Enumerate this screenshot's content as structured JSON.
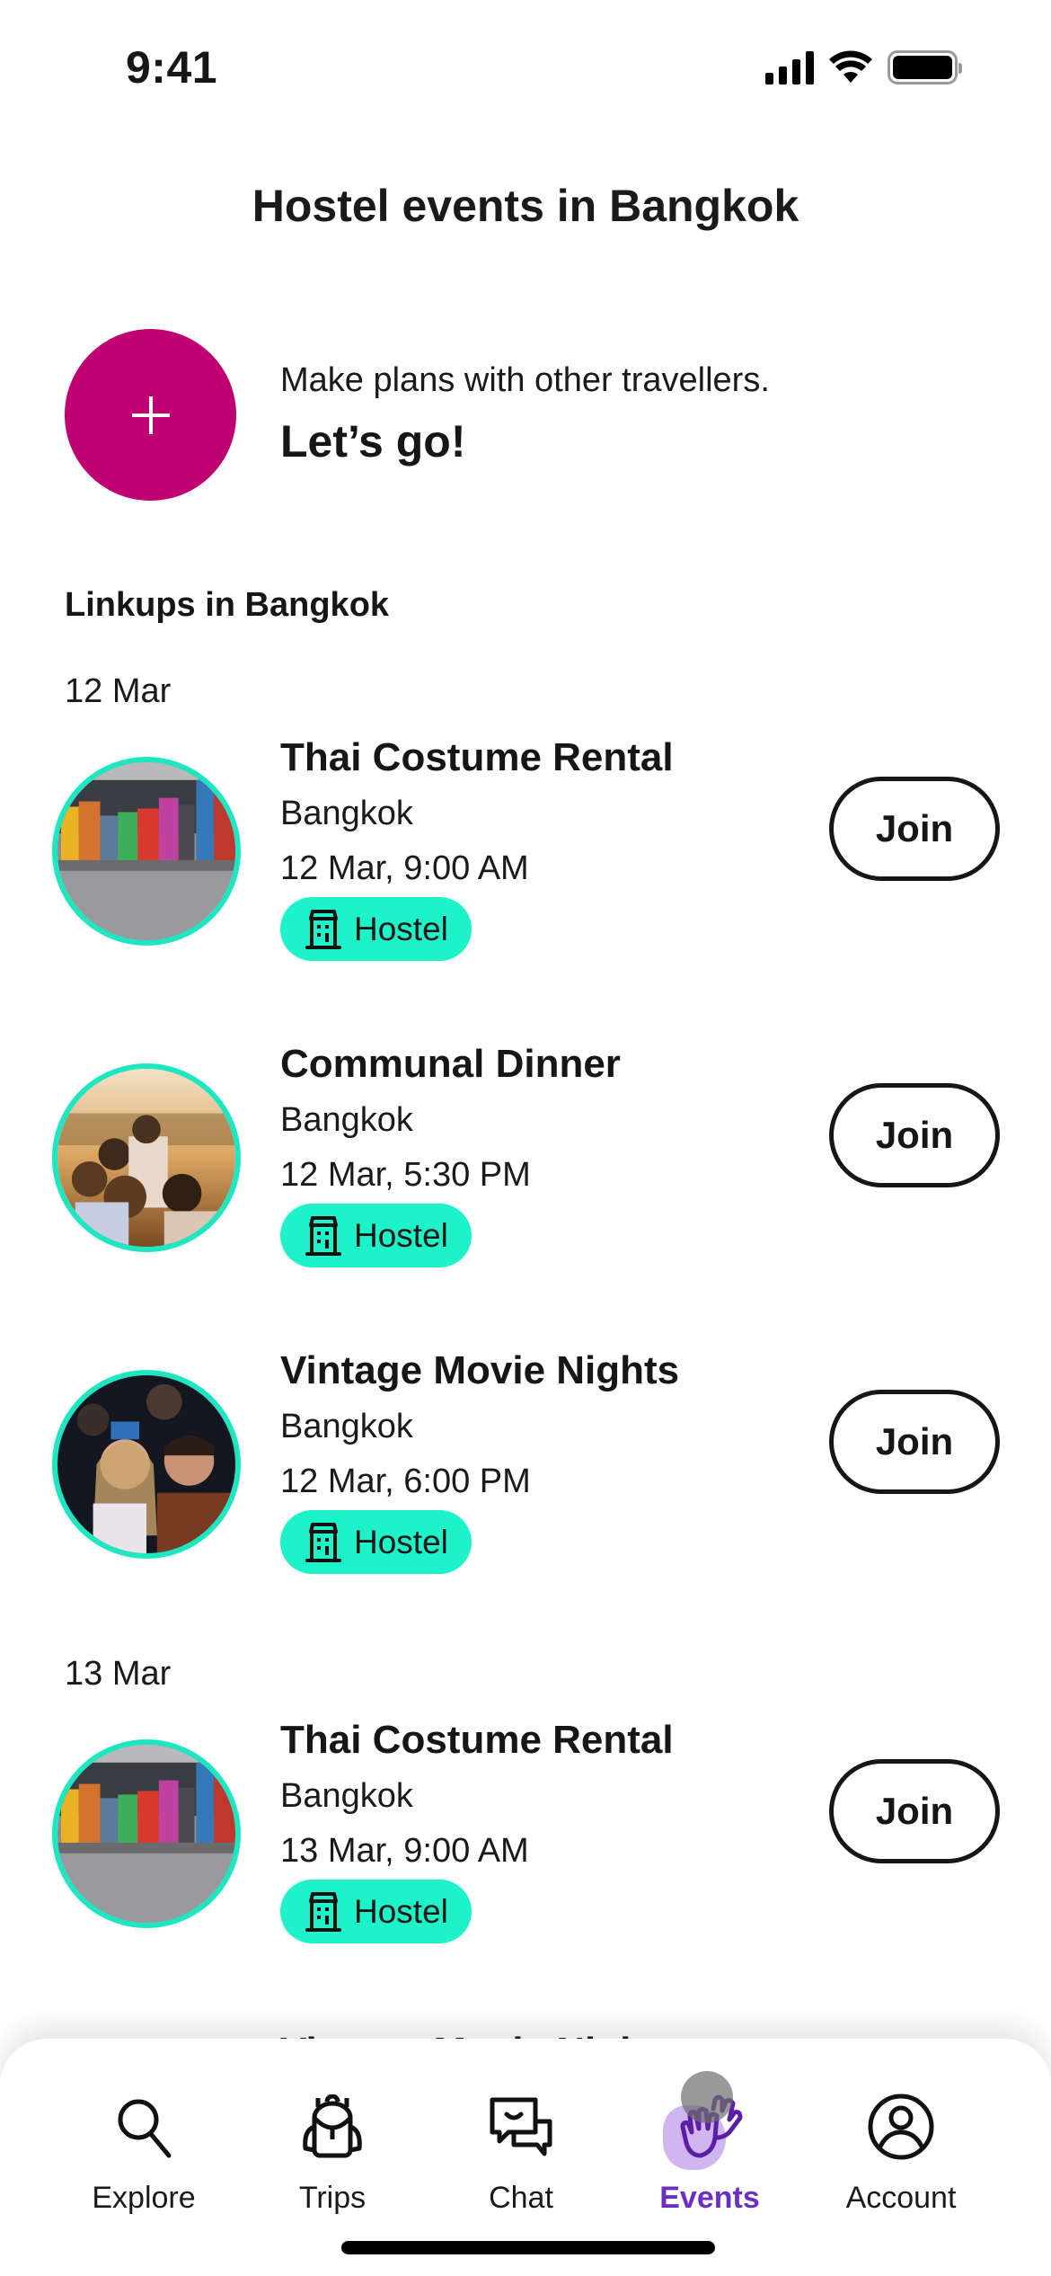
{
  "status_bar": {
    "time": "9:41",
    "icons": [
      "signal-icon",
      "wifi-icon",
      "battery-icon"
    ]
  },
  "header": {
    "title": "Hostel events in Bangkok"
  },
  "create": {
    "subtitle": "Make plans with other travellers.",
    "cta": "Let’s go!",
    "icon": "plus-icon",
    "color": "#BE0072"
  },
  "section": {
    "title": "Linkups in Bangkok"
  },
  "groups": [
    {
      "date": "12 Mar"
    },
    {
      "date": "13 Mar"
    }
  ],
  "events": [
    {
      "title": "Thai Costume Rental",
      "location": "Bangkok",
      "datetime": "12 Mar, 9:00 AM",
      "badge": "Hostel",
      "join_label": "Join",
      "photo": "costume-street-photo"
    },
    {
      "title": "Communal Dinner",
      "location": "Bangkok",
      "datetime": "12 Mar, 5:30 PM",
      "badge": "Hostel",
      "join_label": "Join",
      "photo": "sunset-dinner-photo"
    },
    {
      "title": "Vintage Movie Nights",
      "location": "Bangkok",
      "datetime": "12 Mar, 6:00 PM",
      "badge": "Hostel",
      "join_label": "Join",
      "photo": "cinema-audience-photo"
    },
    {
      "title": "Thai Costume Rental",
      "location": "Bangkok",
      "datetime": "13 Mar, 9:00 AM",
      "badge": "Hostel",
      "join_label": "Join",
      "photo": "costume-street-photo"
    }
  ],
  "peek_title": "Vintage Movie Nights",
  "colors": {
    "badge": "#1EF2C8",
    "avatar_ring": "#1EE6C1",
    "active_tab": "#6B2FC4",
    "create": "#BE0072"
  },
  "tabs": [
    {
      "label": "Explore",
      "icon": "search-icon",
      "active": false
    },
    {
      "label": "Trips",
      "icon": "backpack-icon",
      "active": false
    },
    {
      "label": "Chat",
      "icon": "chat-bubbles-icon",
      "active": false
    },
    {
      "label": "Events",
      "icon": "waving-hands-icon",
      "active": true
    },
    {
      "label": "Account",
      "icon": "user-circle-icon",
      "active": false
    }
  ]
}
